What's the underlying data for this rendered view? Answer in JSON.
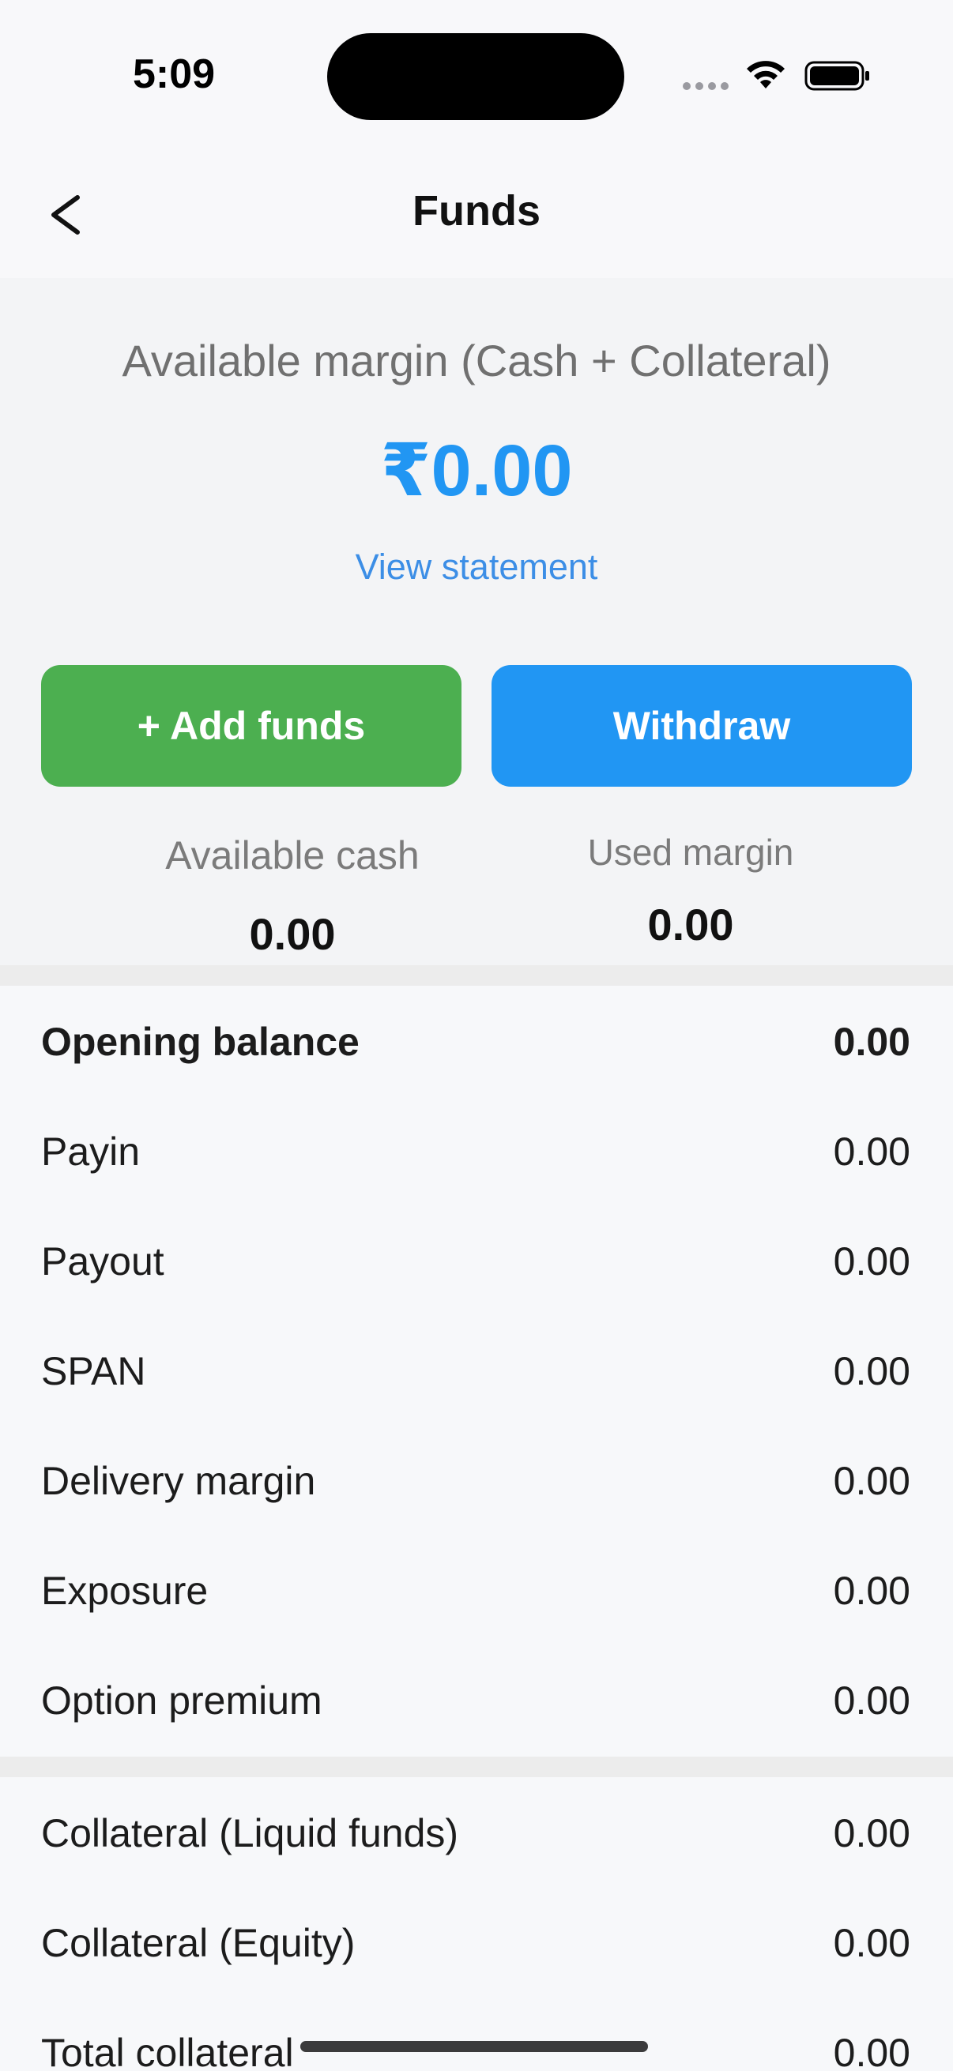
{
  "status_bar": {
    "time": "5:09"
  },
  "header": {
    "title": "Funds",
    "back_icon": "chevron-left-icon"
  },
  "summary": {
    "margin_label": "Available margin (Cash + Collateral)",
    "margin_value": "₹0.00",
    "view_statement": "View statement",
    "add_funds_label": "+ Add funds",
    "withdraw_label": "Withdraw",
    "available_cash_label": "Available cash",
    "available_cash_value": "0.00",
    "used_margin_label": "Used margin",
    "used_margin_value": "0.00"
  },
  "breakdown": [
    {
      "label": "Opening balance",
      "value": "0.00"
    },
    {
      "label": "Payin",
      "value": "0.00"
    },
    {
      "label": "Payout",
      "value": "0.00"
    },
    {
      "label": "SPAN",
      "value": "0.00"
    },
    {
      "label": "Delivery margin",
      "value": "0.00"
    },
    {
      "label": "Exposure",
      "value": "0.00"
    },
    {
      "label": "Option premium",
      "value": "0.00"
    }
  ],
  "collateral": [
    {
      "label": "Collateral (Liquid funds)",
      "value": "0.00"
    },
    {
      "label": "Collateral (Equity)",
      "value": "0.00"
    },
    {
      "label": "Total collateral",
      "value": "0.00"
    }
  ],
  "colors": {
    "accent_blue": "#2196f3",
    "add_green": "#4caf50"
  }
}
